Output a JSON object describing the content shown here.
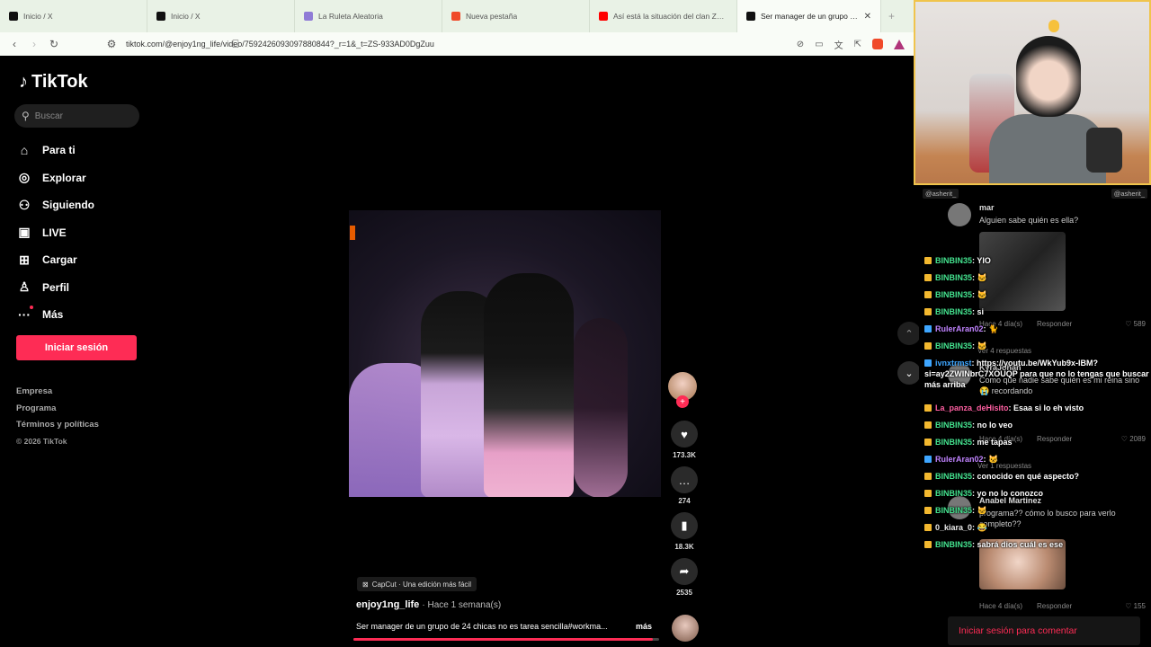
{
  "browser": {
    "tabs": [
      {
        "label": "Inicio / X",
        "icon": "x-logo-icon",
        "color": "#111111"
      },
      {
        "label": "Inicio / X",
        "icon": "x-logo-icon",
        "color": "#111111"
      },
      {
        "label": "La Ruleta Aleatoria",
        "icon": "roulette-icon",
        "color": "#8f7bd6"
      },
      {
        "label": "Nueva pestaña",
        "icon": "brave-shield-icon",
        "color": "#f04a2a"
      },
      {
        "label": "Así está la situación del clan Zenin e",
        "icon": "youtube-icon",
        "color": "#ff0000"
      },
      {
        "label": "Ser manager de un grupo de",
        "icon": "tiktok-icon",
        "color": "#111111"
      }
    ],
    "active_tab_index": 5,
    "url": "tiktok.com/@enjoy1ng_life/video/7592426093097880844?_r=1&_t=ZS-933AD0DgZuu"
  },
  "tiktok": {
    "logo_text": "TikTok",
    "search_placeholder": "Buscar",
    "nav": [
      {
        "label": "Para ti",
        "icon": "home-icon",
        "glyph": "⌂"
      },
      {
        "label": "Explorar",
        "icon": "compass-icon",
        "glyph": "◎"
      },
      {
        "label": "Siguiendo",
        "icon": "following-icon",
        "glyph": "⚇"
      },
      {
        "label": "LIVE",
        "icon": "live-icon",
        "glyph": "▣"
      },
      {
        "label": "Cargar",
        "icon": "upload-icon",
        "glyph": "⊞"
      },
      {
        "label": "Perfil",
        "icon": "profile-icon",
        "glyph": "♙"
      },
      {
        "label": "Más",
        "icon": "more-icon",
        "glyph": "···"
      }
    ],
    "login_label": "Iniciar sesión",
    "footer": [
      "Empresa",
      "Programa",
      "Términos y políticas"
    ],
    "copyright": "© 2026 TikTok",
    "video": {
      "capcut": "CapCut · Una edición más fácil",
      "author": "enjoy1ng_life",
      "posted": "· Hace 1 semana(s)",
      "description": "Ser manager de un grupo de 24 chicas no es tarea sencilla#workma...",
      "more": "más",
      "progress": 0.98
    },
    "actions": {
      "likes": "173.3K",
      "comments": "274",
      "saves": "18.3K",
      "shares": "2535"
    }
  },
  "stream": {
    "chat_header_left": "@asherit_",
    "chat_header_right": "@asherit_",
    "comments": [
      {
        "name": "mar",
        "text": "Alguien sabe quién es ella?",
        "when": "Hace 4 día(s)",
        "reply": "Responder",
        "likes": "589"
      },
      {
        "name": "KyraJohan",
        "text": "Como que nadie sabe quién es mi reina sino 😭 recordando",
        "when": "Hace 4 día(s)",
        "reply": "Responder",
        "likes": "2089"
      },
      {
        "name": "Anabel Martinez",
        "text": "programa?? cómo lo busco para verlo completo??",
        "when": "Hace 4 día(s)",
        "reply": "Responder",
        "likes": "155"
      }
    ],
    "replies_1": "Ver 4 respuestas",
    "replies_2": "Ver 1 respuestas",
    "messages": [
      {
        "user": "BINBIN35",
        "text": ": YIO",
        "cls": "",
        "badge": ""
      },
      {
        "user": "BINBIN35",
        "text": ": 🐱",
        "cls": "",
        "badge": ""
      },
      {
        "user": "BINBIN35",
        "text": ": 🐱",
        "cls": "",
        "badge": ""
      },
      {
        "user": "BINBIN35",
        "text": ": si",
        "cls": "",
        "badge": ""
      },
      {
        "user": "RulerAran02",
        "text": ": 🐈",
        "cls": "purple",
        "badge": "blue"
      },
      {
        "user": "BINBIN35",
        "text": ": 🐱",
        "cls": "",
        "badge": ""
      },
      {
        "user": "ivnxtrmst",
        "text": ": https://youtu.be/WkYub9x-IBM?si=ay2ZWINbrC7XOUQP para que no lo tengas que buscar más arriba",
        "cls": "blue",
        "badge": "blue"
      },
      {
        "user": "La_panza_deHisito",
        "text": ": Esaa si lo eh visto",
        "cls": "pink",
        "badge": ""
      },
      {
        "user": "BINBIN35",
        "text": ": no lo veo",
        "cls": "",
        "badge": ""
      },
      {
        "user": "BINBIN35",
        "text": ": me tapas",
        "cls": "",
        "badge": ""
      },
      {
        "user": "RulerAran02",
        "text": ": 🐱",
        "cls": "purple",
        "badge": "blue"
      },
      {
        "user": "BINBIN35",
        "text": ": conocido en qué aspecto?",
        "cls": "",
        "badge": ""
      },
      {
        "user": "BINBIN35",
        "text": ": yo no lo conozco",
        "cls": "",
        "badge": ""
      },
      {
        "user": "BINBIN35",
        "text": ": 🐱",
        "cls": "",
        "badge": ""
      },
      {
        "user": "0_kiara_0",
        "text": ": 😂",
        "cls": "white",
        "badge": ""
      },
      {
        "user": "BINBIN35",
        "text": ": sabrá dios cuál es ese",
        "cls": "",
        "badge": ""
      }
    ],
    "comment_login": "Iniciar sesión para comentar"
  }
}
